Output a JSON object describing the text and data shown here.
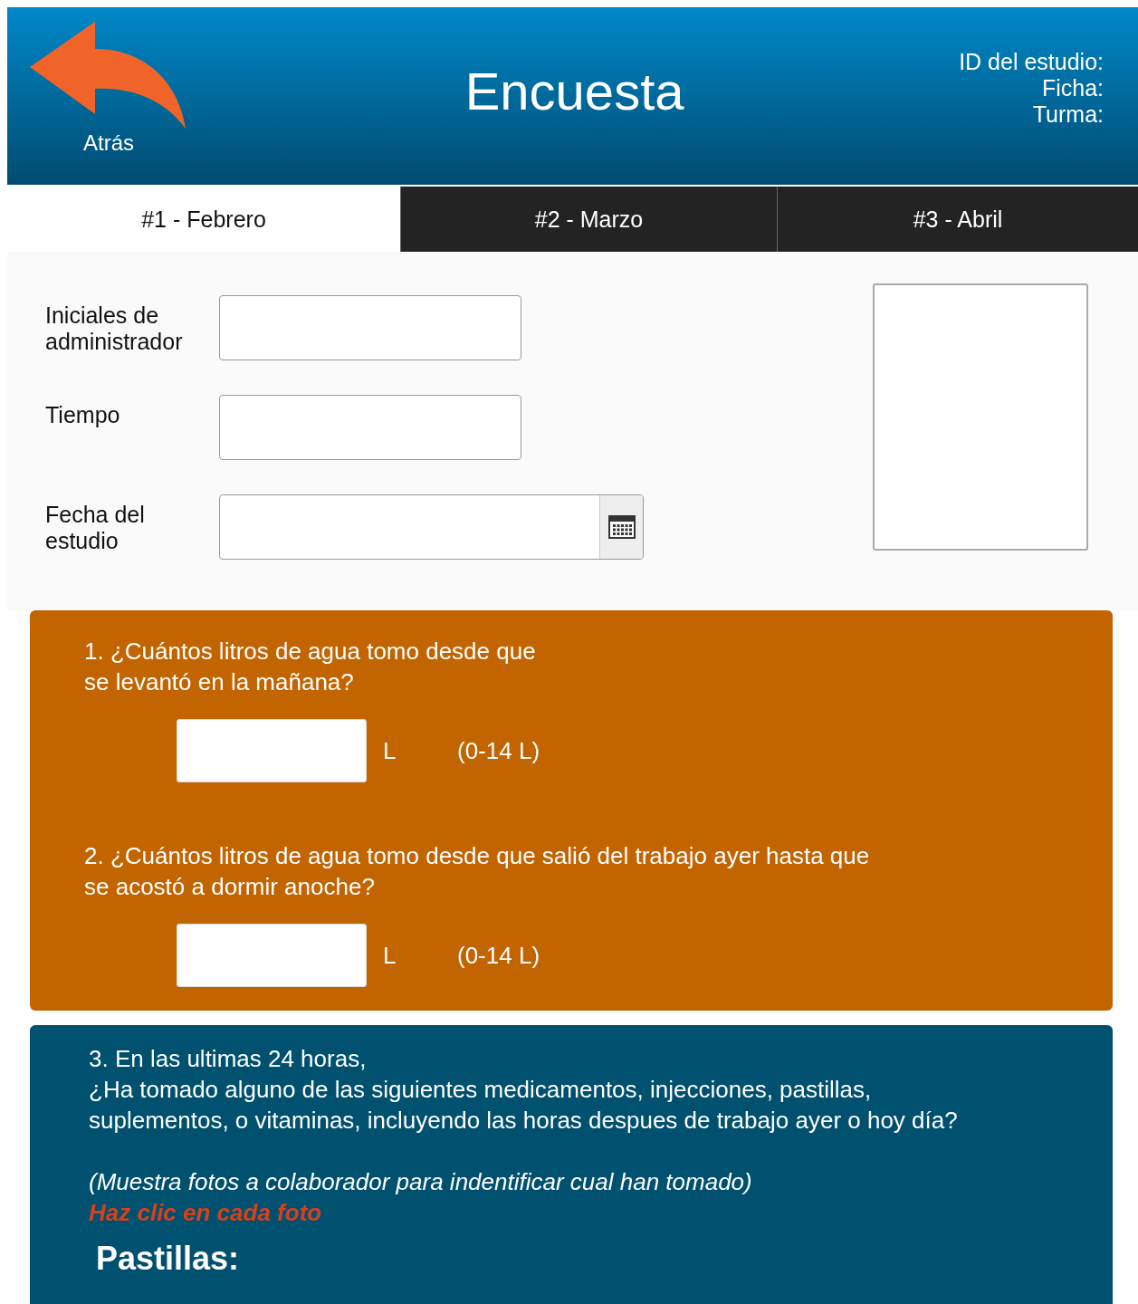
{
  "header": {
    "back_label": "Atrás",
    "title": "Encuesta",
    "study_info": [
      "ID del estudio:",
      "Ficha:",
      "Turma:"
    ]
  },
  "tabs": [
    {
      "label": "#1 - Febrero",
      "selected": true
    },
    {
      "label": "#2 - Marzo",
      "selected": false
    },
    {
      "label": "#3 - Abril",
      "selected": false
    }
  ],
  "fields": [
    {
      "label": "Iniciales de administrador",
      "kind": "text"
    },
    {
      "label": "Tiempo",
      "kind": "text"
    },
    {
      "label": "Fecha del estudio",
      "kind": "date"
    }
  ],
  "questions": [
    {
      "lines": [
        "1. ¿Cuántos litros de agua tomo desde que",
        "se levantó en la mañana?"
      ],
      "unit": "L",
      "range": "(0-14 L)"
    },
    {
      "lines": [
        "2. ¿Cuántos litros de agua tomo desde que salió del trabajo ayer hasta que",
        "se acostó a dormir anoche?"
      ],
      "unit": "L",
      "range": "(0-14 L)"
    }
  ],
  "section_3": {
    "lines": [
      "3. En las ultimas 24 horas,",
      "¿Ha tomado alguno de las siguientes medicamentos, injecciones, pastillas,",
      "suplementos, o vitaminas, incluyendo las horas despues de trabajo ayer o hoy día?"
    ],
    "note": "(Muestra fotos a colaborador para indentificar cual han tomado)",
    "instruction": "Haz clic en cada foto",
    "subheading": "Pastillas:"
  }
}
